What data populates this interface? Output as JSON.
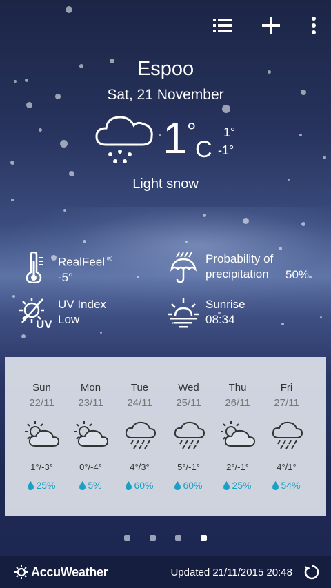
{
  "toolbar": {
    "list_icon": "list-icon",
    "add_icon": "plus-icon",
    "menu_icon": "overflow-menu-icon"
  },
  "location": {
    "city": "Espoo",
    "date": "Sat, 21 November"
  },
  "current": {
    "temperature": "1",
    "degree": "°",
    "unit": "C",
    "high": "1°",
    "low": "-1°",
    "condition": "Light snow",
    "icon": "snow-cloud-icon"
  },
  "details": {
    "realfeel": {
      "label": "RealFeel",
      "mark": "®",
      "value": "-5°",
      "icon": "thermometer-icon"
    },
    "precipitation": {
      "label_line1": "Probability of",
      "label_line2": "precipitation",
      "value": "50%",
      "icon": "umbrella-rain-icon"
    },
    "uv": {
      "label": "UV Index",
      "value": "Low",
      "icon": "uv-sun-icon"
    },
    "sunrise": {
      "label": "Sunrise",
      "value": "08:34",
      "icon": "sunrise-icon"
    }
  },
  "forecast": [
    {
      "day": "Sun",
      "date": "22/11",
      "temp": "1°/-3°",
      "precip": "25%",
      "icon": "partly-cloudy-icon"
    },
    {
      "day": "Mon",
      "date": "23/11",
      "temp": "0°/-4°",
      "precip": "5%",
      "icon": "partly-cloudy-icon"
    },
    {
      "day": "Tue",
      "date": "24/11",
      "temp": "4°/3°",
      "precip": "60%",
      "icon": "rain-cloud-icon"
    },
    {
      "day": "Wed",
      "date": "25/11",
      "temp": "5°/-1°",
      "precip": "60%",
      "icon": "rain-cloud-icon"
    },
    {
      "day": "Thu",
      "date": "26/11",
      "temp": "2°/-1°",
      "precip": "25%",
      "icon": "partly-cloudy-icon"
    },
    {
      "day": "Fri",
      "date": "27/11",
      "temp": "4°/1°",
      "precip": "54%",
      "icon": "rain-cloud-icon"
    }
  ],
  "pager": {
    "pages": 4,
    "active": 4
  },
  "footer": {
    "brand": "AccuWeather",
    "updated": "Updated 21/11/2015 20:48",
    "refresh_icon": "refresh-icon"
  },
  "colors": {
    "precip_accent": "#1aa0c4",
    "panel": "#dce0e8",
    "footer_bg": "#161e3f"
  }
}
